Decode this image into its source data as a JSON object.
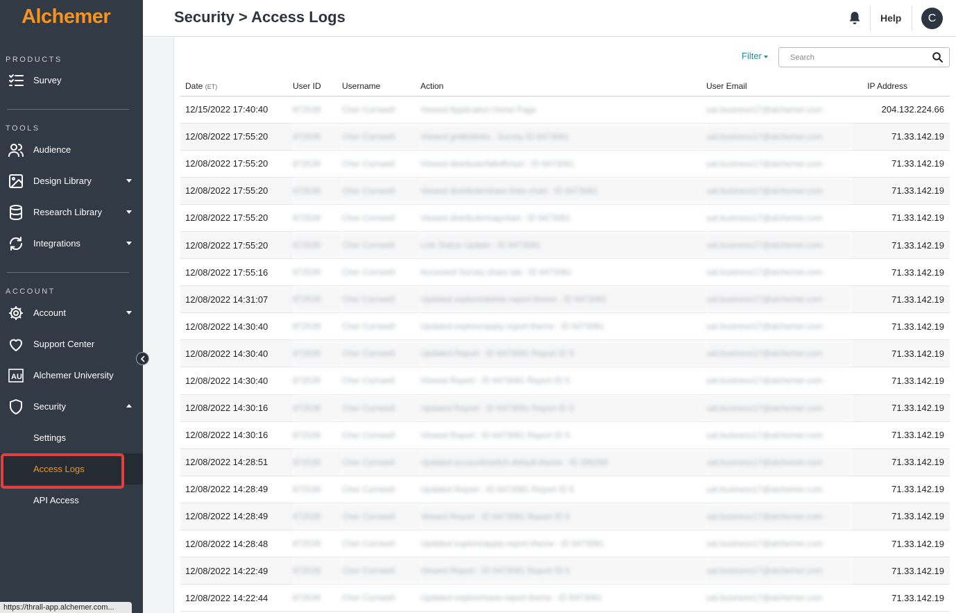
{
  "app": {
    "name": "Alchemer"
  },
  "sidebar": {
    "products_title": "PRODUCTS",
    "tools_title": "TOOLS",
    "account_title": "ACCOUNT",
    "products": [
      {
        "label": "Survey",
        "icon": "survey-list-icon"
      }
    ],
    "tools": [
      {
        "label": "Audience",
        "icon": "people-icon"
      },
      {
        "label": "Design Library",
        "icon": "image-icon"
      },
      {
        "label": "Research Library",
        "icon": "database-icon"
      },
      {
        "label": "Integrations",
        "icon": "sync-icon"
      }
    ],
    "account": [
      {
        "label": "Account",
        "icon": "gear-icon"
      },
      {
        "label": "Support Center",
        "icon": "heart-icon"
      },
      {
        "label": "Alchemer University",
        "icon": "au-icon"
      },
      {
        "label": "Security",
        "icon": "shield-icon"
      }
    ],
    "security_sub": [
      {
        "label": "Settings"
      },
      {
        "label": "Access Logs",
        "active": true
      },
      {
        "label": "API Access"
      }
    ],
    "status_url": "https://thrall-app.alchemer.com..."
  },
  "header": {
    "title": "Security > Access Logs",
    "help": "Help",
    "avatar_initial": "C"
  },
  "toolbar": {
    "filter_label": "Filter",
    "search_placeholder": "Search"
  },
  "table": {
    "columns": {
      "date": "Date",
      "date_suffix": "(ET)",
      "user_id": "User ID",
      "username": "Username",
      "action": "Action",
      "email": "User Email",
      "ip": "IP Address"
    },
    "rows": [
      {
        "date": "12/15/2022 17:40:40",
        "uid": "872539",
        "uname": "Cher Cornwell",
        "action": "Viewed Application Home Page",
        "email": "uat.business17@alchemer.com",
        "ip": "204.132.224.66"
      },
      {
        "date": "12/08/2022 17:55:20",
        "uid": "872539",
        "uname": "Cher Cornwell",
        "action": "Viewed gridlistlinks : Survey ID 6473081",
        "email": "uat.business17@alchemer.com",
        "ip": "71.33.142.19"
      },
      {
        "date": "12/08/2022 17:55:20",
        "uid": "872539",
        "uname": "Cher Cornwell",
        "action": "Viewed distribute/falloffchart : ID 6473081",
        "email": "uat.business17@alchemer.com",
        "ip": "71.33.142.19"
      },
      {
        "date": "12/08/2022 17:55:20",
        "uid": "872539",
        "uname": "Cher Cornwell",
        "action": "Viewed distribute/share-links-chart : ID 6473081",
        "email": "uat.business17@alchemer.com",
        "ip": "71.33.142.19"
      },
      {
        "date": "12/08/2022 17:55:20",
        "uid": "872539",
        "uname": "Cher Cornwell",
        "action": "Viewed distribute/mapchart : ID 6473081",
        "email": "uat.business17@alchemer.com",
        "ip": "71.33.142.19"
      },
      {
        "date": "12/08/2022 17:55:20",
        "uid": "872539",
        "uname": "Cher Cornwell",
        "action": "Link Status Update : ID 6473081",
        "email": "uat.business17@alchemer.com",
        "ip": "71.33.142.19"
      },
      {
        "date": "12/08/2022 17:55:16",
        "uid": "872539",
        "uname": "Cher Cornwell",
        "action": "Accessed Survey share tab : ID 6473081",
        "email": "uat.business17@alchemer.com",
        "ip": "71.33.142.19"
      },
      {
        "date": "12/08/2022 14:31:07",
        "uid": "872539",
        "uname": "Cher Cornwell",
        "action": "Updated explore/delete-report-theme : ID 6473081",
        "email": "uat.business17@alchemer.com",
        "ip": "71.33.142.19"
      },
      {
        "date": "12/08/2022 14:30:40",
        "uid": "872539",
        "uname": "Cher Cornwell",
        "action": "Updated explore/apply-report-theme : ID 6473081",
        "email": "uat.business17@alchemer.com",
        "ip": "71.33.142.19"
      },
      {
        "date": "12/08/2022 14:30:40",
        "uid": "872539",
        "uname": "Cher Cornwell",
        "action": "Updated Report : ID 6473081 Report ID 5",
        "email": "uat.business17@alchemer.com",
        "ip": "71.33.142.19"
      },
      {
        "date": "12/08/2022 14:30:40",
        "uid": "872539",
        "uname": "Cher Cornwell",
        "action": "Viewed Report : ID 6473081 Report ID 5",
        "email": "uat.business17@alchemer.com",
        "ip": "71.33.142.19"
      },
      {
        "date": "12/08/2022 14:30:16",
        "uid": "872539",
        "uname": "Cher Cornwell",
        "action": "Updated Report : ID 6473081 Report ID 5",
        "email": "uat.business17@alchemer.com",
        "ip": "71.33.142.19"
      },
      {
        "date": "12/08/2022 14:30:16",
        "uid": "872539",
        "uname": "Cher Cornwell",
        "action": "Viewed Report : ID 6473081 Report ID 5",
        "email": "uat.business17@alchemer.com",
        "ip": "71.33.142.19"
      },
      {
        "date": "12/08/2022 14:28:51",
        "uid": "872539",
        "uname": "Cher Cornwell",
        "action": "Updated account/switch-default-theme : ID 266299",
        "email": "uat.business17@alchemer.com",
        "ip": "71.33.142.19"
      },
      {
        "date": "12/08/2022 14:28:49",
        "uid": "872539",
        "uname": "Cher Cornwell",
        "action": "Updated Report : ID 6473081 Report ID 5",
        "email": "uat.business17@alchemer.com",
        "ip": "71.33.142.19"
      },
      {
        "date": "12/08/2022 14:28:49",
        "uid": "872539",
        "uname": "Cher Cornwell",
        "action": "Viewed Report : ID 6473081 Report ID 5",
        "email": "uat.business17@alchemer.com",
        "ip": "71.33.142.19"
      },
      {
        "date": "12/08/2022 14:28:48",
        "uid": "872539",
        "uname": "Cher Cornwell",
        "action": "Updated explore/apply-report-theme : ID 6473081",
        "email": "uat.business17@alchemer.com",
        "ip": "71.33.142.19"
      },
      {
        "date": "12/08/2022 14:22:49",
        "uid": "872539",
        "uname": "Cher Cornwell",
        "action": "Viewed Report : ID 6473081 Report ID 5",
        "email": "uat.business17@alchemer.com",
        "ip": "71.33.142.19"
      },
      {
        "date": "12/08/2022 14:22:44",
        "uid": "872539",
        "uname": "Cher Cornwell",
        "action": "Updated explore/save-report-theme : ID 6473081",
        "email": "uat.business17@alchemer.com",
        "ip": "71.33.142.19"
      }
    ]
  },
  "colors": {
    "sidebar": "#313a45",
    "accent": "#f7941d",
    "highlight": "#e53e3e",
    "link": "#2a8c8c"
  }
}
